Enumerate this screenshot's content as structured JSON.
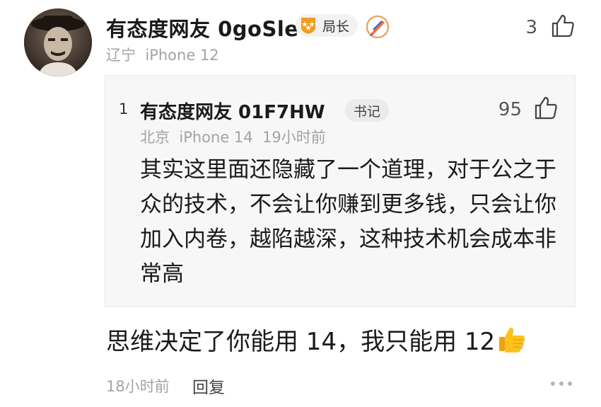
{
  "comment": {
    "username": "有态度网友 0goSle",
    "rank_badge": "局长",
    "location": "辽宁",
    "device": "iPhone 12",
    "like_count": "3",
    "text": "思维决定了你能用 14，我只能用 12",
    "time": "18小时前",
    "reply_label": "回复"
  },
  "quoted_reply": {
    "floor": "1",
    "username": "有态度网友 01F7HW",
    "badge": "书记",
    "location": "北京",
    "device": "iPhone 14",
    "time": "19小时前",
    "like_count": "95",
    "text": "其实这里面还隐藏了一个道理，对于公之于众的技术，不会让你赚到更多钱，只会让你加入内卷，越陷越深，这种技术机会成本非常高"
  },
  "icons": {
    "like": "thumbs-up-outline-icon",
    "rank": "rank-shield-icon",
    "edit": "pen-badge-icon",
    "emoji": "thumbs-up-emoji",
    "more": "more-dots-icon"
  },
  "colors": {
    "rank_badge": "#f39c1f",
    "muted_text": "#a3a3a3",
    "quote_bg": "#f7f7f7"
  }
}
